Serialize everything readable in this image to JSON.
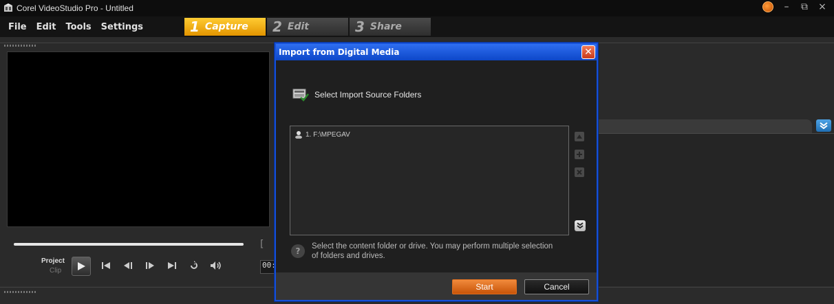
{
  "window": {
    "title": "Corel VideoStudio Pro - Untitled",
    "controls": {
      "minimize": "–",
      "restore": "⧉",
      "close": "×"
    }
  },
  "menu": {
    "items": [
      "File",
      "Edit",
      "Tools",
      "Settings"
    ]
  },
  "steps": [
    {
      "num": "1",
      "label": "Capture"
    },
    {
      "num": "2",
      "label": "Edit"
    },
    {
      "num": "3",
      "label": "Share"
    }
  ],
  "player": {
    "project_label": "Project",
    "clip_label": "Clip",
    "timecode": "00:"
  },
  "dialog": {
    "title": "Import from Digital Media",
    "close_glyph": "✕",
    "section_label": "Select Import Source Folders",
    "folders": [
      {
        "label": "1. F:\\MPEGAV"
      }
    ],
    "help_text": "Select the content folder or drive. You may perform multiple selection of folders and drives.",
    "start_label": "Start",
    "cancel_label": "Cancel"
  },
  "colors": {
    "accent_orange": "#e29400",
    "dialog_blue": "#1550d8",
    "start_button": "#c85408"
  }
}
